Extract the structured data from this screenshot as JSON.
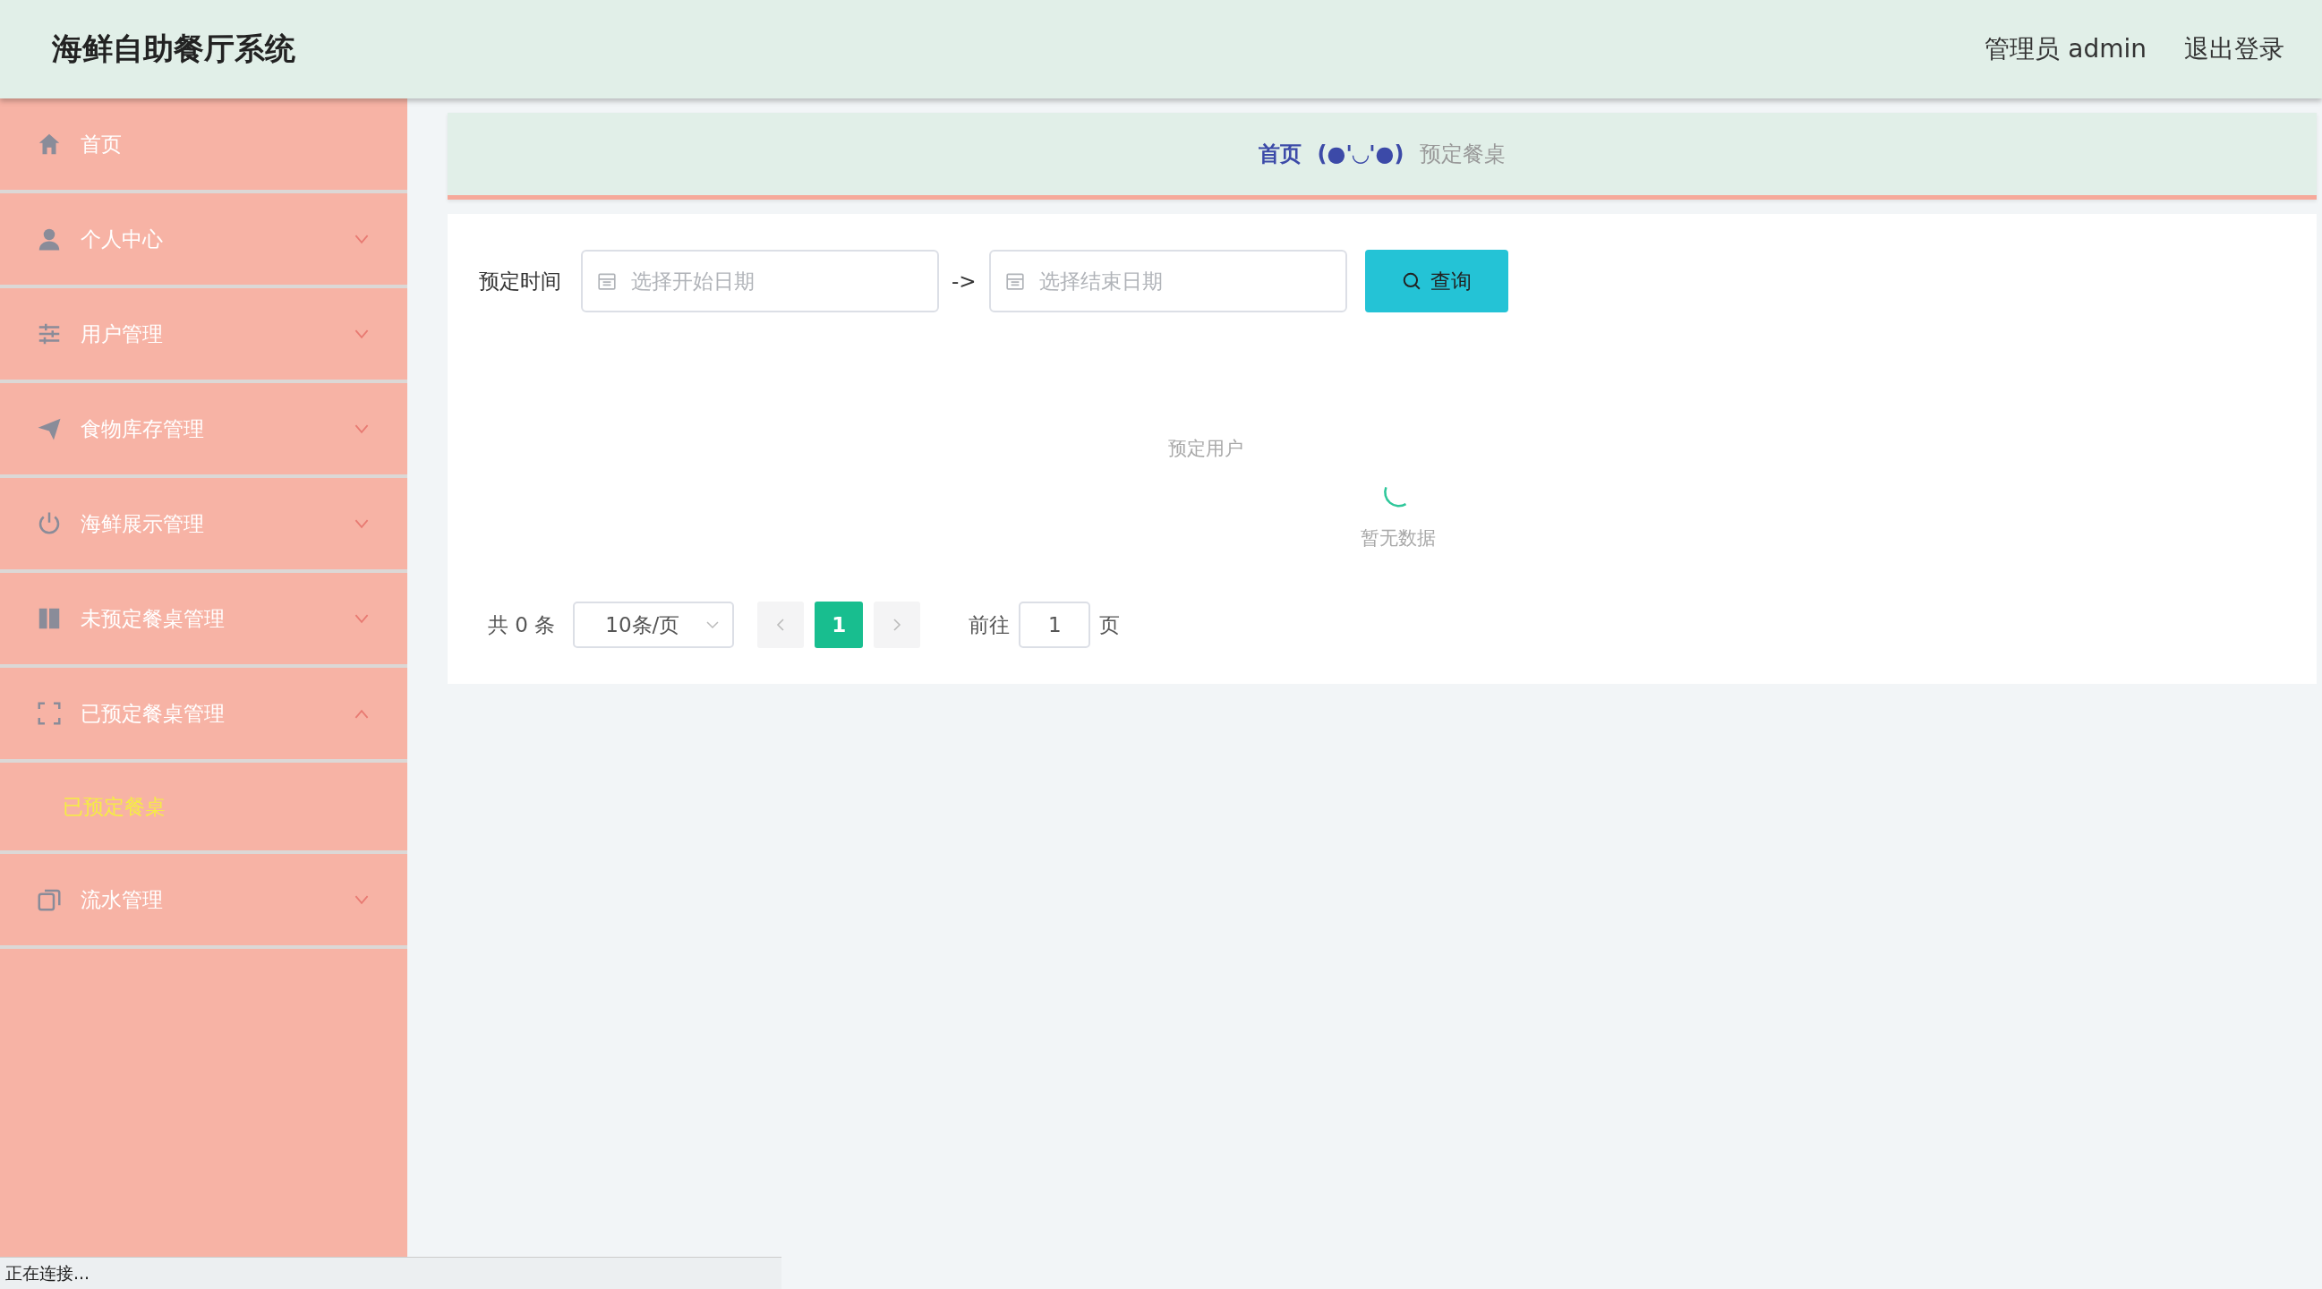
{
  "header": {
    "title": "海鲜自助餐厅系统",
    "user": "管理员 admin",
    "logout": "退出登录"
  },
  "sidebar": {
    "items": [
      {
        "label": "首页"
      },
      {
        "label": "个人中心",
        "expanded": false
      },
      {
        "label": "用户管理",
        "expanded": false
      },
      {
        "label": "食物库存管理",
        "expanded": false
      },
      {
        "label": "海鲜展示管理",
        "expanded": false
      },
      {
        "label": "未预定餐桌管理",
        "expanded": false
      },
      {
        "label": "已预定餐桌管理",
        "expanded": true,
        "children": [
          {
            "label": "已预定餐桌",
            "selected": true
          }
        ]
      },
      {
        "label": "流水管理",
        "expanded": false
      }
    ]
  },
  "breadcrumb": {
    "home": "首页",
    "separator": "(●'◡'●)",
    "current": "预定餐桌"
  },
  "search": {
    "label": "预定时间",
    "start_placeholder": "选择开始日期",
    "arrow": "->",
    "end_placeholder": "选择结束日期",
    "button": "查询"
  },
  "table": {
    "columns": [
      "预定用户"
    ],
    "empty_text": "暂无数据",
    "loading": true
  },
  "pagination": {
    "total": "共 0 条",
    "page_size": "10条/页",
    "pages": [
      {
        "label": "1",
        "selected": true
      }
    ],
    "goto_label": "前往",
    "goto_value": "1",
    "goto_suffix": "页"
  },
  "status_bar": "正在连接..."
}
